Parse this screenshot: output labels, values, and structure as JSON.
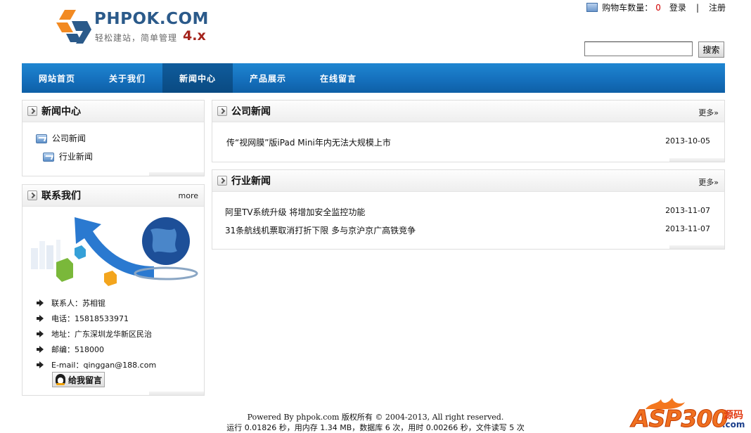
{
  "header": {
    "logo_title": "PHPOK.COM",
    "logo_sub": "轻松建站，简单管理",
    "logo_version": "4.x",
    "cart_label": "购物车数量：",
    "cart_count": "0",
    "login": "登录",
    "separator": "|",
    "register": "注册",
    "search_placeholder": "",
    "search_button": "搜索"
  },
  "nav": {
    "items": [
      "网站首页",
      "关于我们",
      "新闻中心",
      "产品展示",
      "在线留言"
    ],
    "active_index": 2
  },
  "sidebar": {
    "news_title": "新闻中心",
    "categories": [
      "公司新闻",
      "行业新闻"
    ],
    "contact_title": "联系我们",
    "contact_more": "more",
    "contact": {
      "person": "联系人：苏相锟",
      "phone": "电话：15818533971",
      "address": "地址：广东深圳龙华新区民治",
      "postcode": "邮编：518000",
      "email": "E-mail：qinggan@188.com"
    },
    "message_button": "给我留言"
  },
  "main": {
    "company": {
      "title": "公司新闻",
      "more": "更多»",
      "items": [
        {
          "title": "传“视网膜”版iPad Mini年内无法大规模上市",
          "date": "2013-10-05"
        }
      ]
    },
    "industry": {
      "title": "行业新闻",
      "more": "更多»",
      "items": [
        {
          "title": "阿里TV系统升级 将增加安全监控功能",
          "date": "2013-11-07"
        },
        {
          "title": "31条航线机票取消打折下限 多与京沪京广高铁竞争",
          "date": "2013-11-07"
        }
      ]
    }
  },
  "footer": {
    "powered": "Powered By phpok.com 版权所有 © 2004-2013, All right reserved.",
    "stats": "运行 0.01826 秒，用内存 1.34 MB，数据库 6 次，用时 0.00266 秒，文件读写 5 次"
  },
  "watermark": {
    "text": "ASP300",
    "side": "源码",
    "com": ".com"
  },
  "colors": {
    "nav_blue": "#1570bd",
    "nav_active": "#0a4a82",
    "cart_count": "#d10000",
    "logo_blue": "#2b5a8a",
    "logo_version": "#a4231b"
  }
}
